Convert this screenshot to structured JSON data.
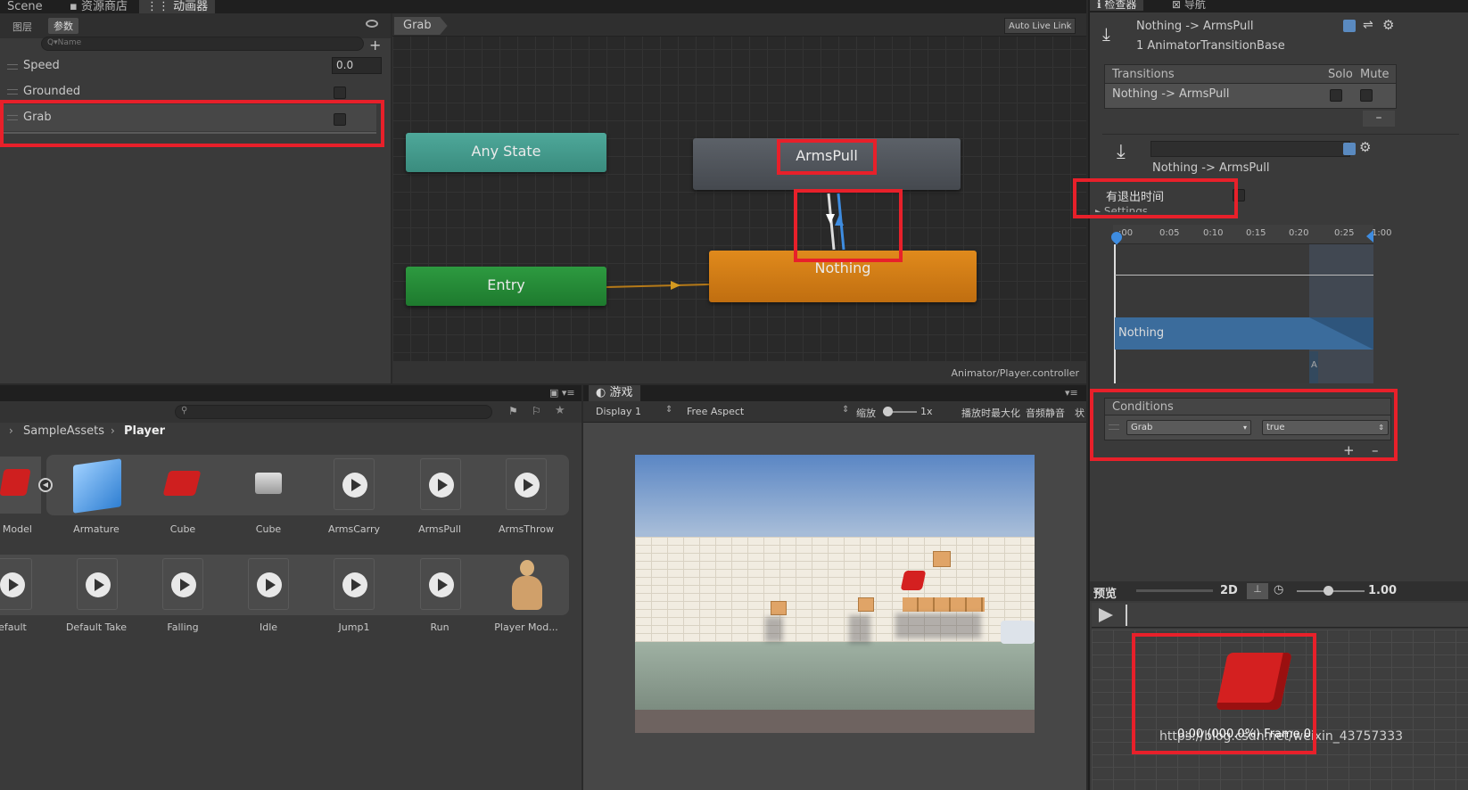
{
  "top_tabs": {
    "scene": "Scene",
    "asset_store": "资源商店",
    "animator": "动画器"
  },
  "inspector_tabs": {
    "inspector": "检查器",
    "navigation": "导航"
  },
  "params": {
    "tab_layers": "图层",
    "tab_params": "参数",
    "search_placeholder": "Q▾Name",
    "items": [
      {
        "name": "Speed",
        "value": "0.0"
      },
      {
        "name": "Grounded"
      },
      {
        "name": "Grab"
      }
    ]
  },
  "graph": {
    "breadcrumb": "Grab",
    "auto_live_link": "Auto Live Link",
    "nodes": {
      "any_state": "Any State",
      "entry": "Entry",
      "arms_pull": "ArmsPull",
      "nothing": "Nothing"
    },
    "footer": "Animator/Player.controller"
  },
  "inspector": {
    "title": "Nothing -> ArmsPull",
    "subtitle": "1 AnimatorTransitionBase",
    "transitions_header": "Transitions",
    "solo_label": "Solo",
    "mute_label": "Mute",
    "transition_row": "Nothing -> ArmsPull",
    "detail_title": "Nothing -> ArmsPull",
    "has_exit_time": "有退出时间",
    "settings_label": "Settings",
    "timeline_ticks": [
      ":00",
      "0:05",
      "0:10",
      "0:15",
      "0:20",
      "0:25",
      "1:00"
    ],
    "timeline_clip": "Nothing",
    "timeline_marker": "A",
    "conditions_header": "Conditions",
    "condition_param": "Grab",
    "condition_value": "true",
    "preview_label": "预览",
    "preview_2d": "2D",
    "preview_speed": "1.00",
    "preview_status": "0:00 (000.0%) Frame 0",
    "watermark": "https://blog.csdn.net/weixin_43757333"
  },
  "project": {
    "breadcrumb_root": "SampleAssets",
    "breadcrumb_current": "Player",
    "assets_row1": [
      "er Model",
      "Armature",
      "Cube",
      "Cube",
      "ArmsCarry",
      "ArmsPull",
      "ArmsThrow"
    ],
    "assets_row2": [
      "efault",
      "Default Take",
      "Falling",
      "Idle",
      "Jump1",
      "Run",
      "Player Mod..."
    ]
  },
  "game": {
    "tab": "游戏",
    "display": "Display 1",
    "aspect": "Free Aspect",
    "scale_label": "缩放",
    "scale_value": "1x",
    "maximize": "播放时最大化",
    "mute": "音频静音",
    "stats": "状"
  },
  "colors": {
    "highlight": "#e8202a",
    "any_state": "#3f9a8c",
    "entry": "#2a8a3a",
    "nothing": "#d17e16",
    "arms_pull": "#4d5258",
    "timeline_blue": "#3b6c9c"
  }
}
